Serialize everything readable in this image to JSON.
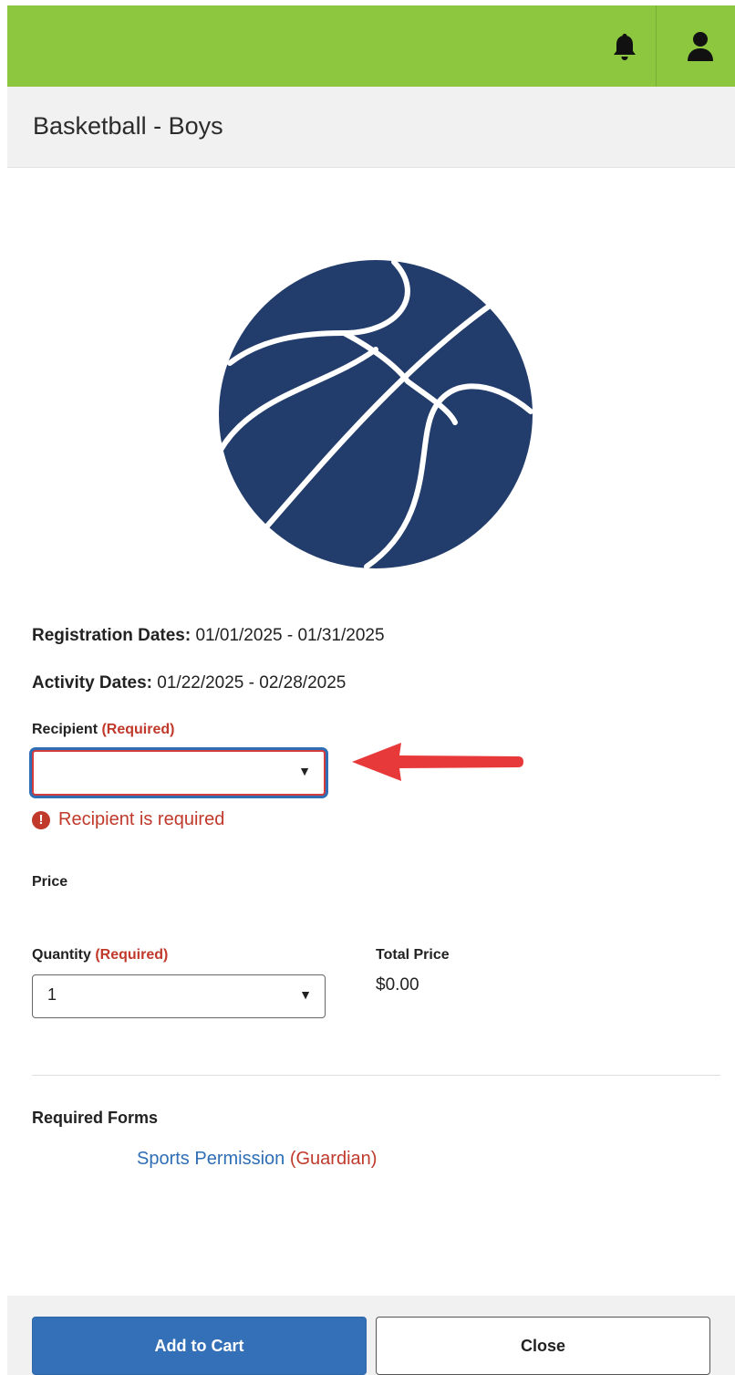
{
  "header": {
    "bell_icon": "bell-icon",
    "user_icon": "user-icon",
    "bg_color": "#8dc63f"
  },
  "title": "Basketball - Boys",
  "image": {
    "icon": "basketball-icon",
    "color": "#223c6b"
  },
  "details": {
    "registration_label": "Registration Dates:",
    "registration_value": "01/01/2025 - 01/31/2025",
    "activity_label": "Activity Dates:",
    "activity_value": "01/22/2025 - 02/28/2025"
  },
  "recipient": {
    "label": "Recipient",
    "required_tag": "(Required)",
    "value": "",
    "caret": "▼",
    "error": "Recipient is required"
  },
  "price": {
    "label": "Price"
  },
  "quantity": {
    "label": "Quantity",
    "required_tag": "(Required)",
    "value": "1",
    "caret": "▼"
  },
  "total": {
    "label": "Total Price",
    "value": "$0.00"
  },
  "forms": {
    "heading": "Required Forms",
    "items": [
      {
        "name": "Sports Permission",
        "role": "(Guardian)"
      }
    ]
  },
  "buttons": {
    "add_to_cart": "Add to Cart",
    "close": "Close"
  },
  "colors": {
    "primary": "#3370b7",
    "error": "#c0392b",
    "annotation_arrow": "#e8393a"
  }
}
